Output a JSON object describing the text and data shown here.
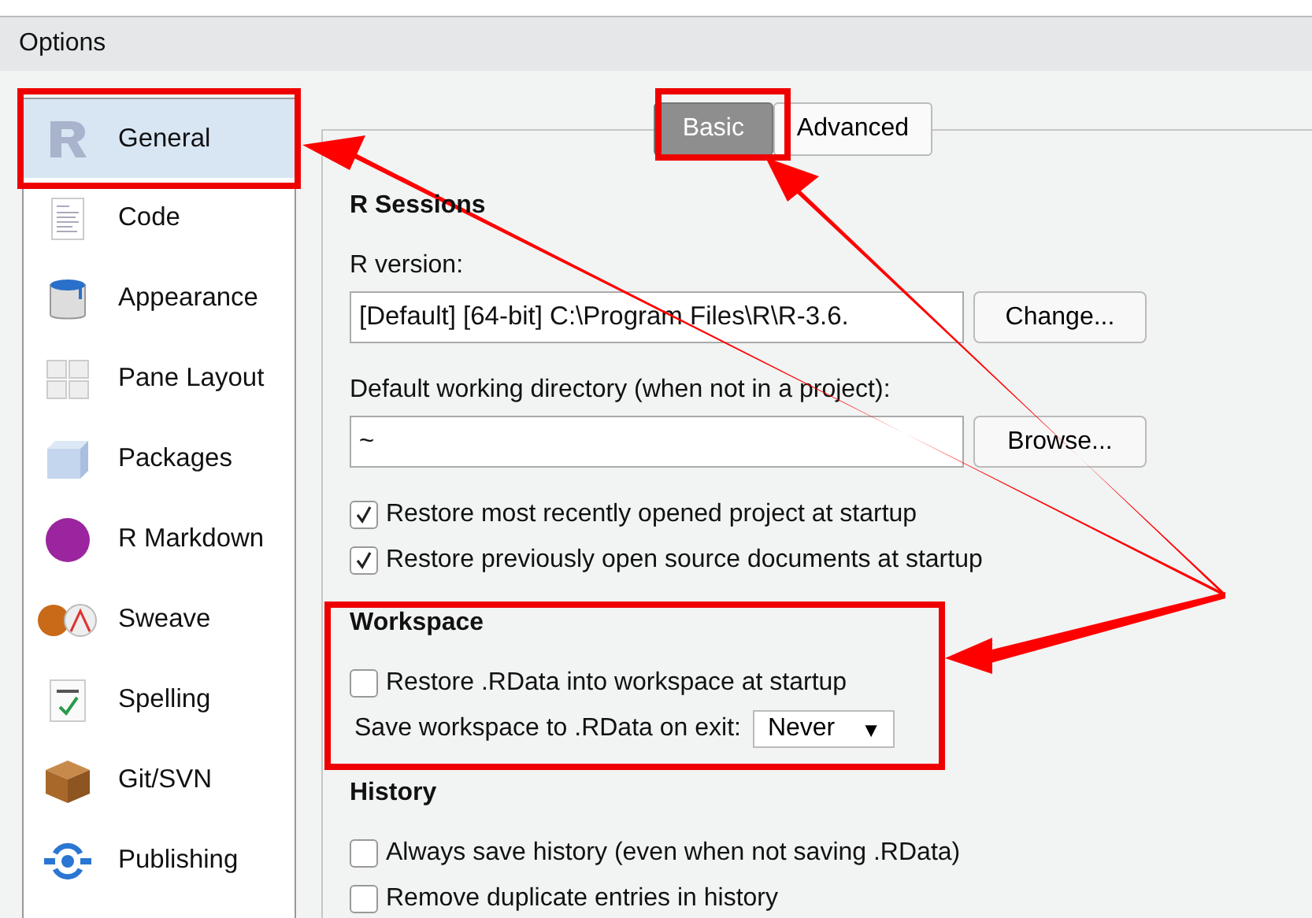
{
  "window": {
    "title": "Options"
  },
  "sidebar": {
    "items": [
      {
        "label": "General",
        "selected": true
      },
      {
        "label": "Code",
        "selected": false
      },
      {
        "label": "Appearance",
        "selected": false
      },
      {
        "label": "Pane Layout",
        "selected": false
      },
      {
        "label": "Packages",
        "selected": false
      },
      {
        "label": "R Markdown",
        "selected": false
      },
      {
        "label": "Sweave",
        "selected": false
      },
      {
        "label": "Spelling",
        "selected": false
      },
      {
        "label": "Git/SVN",
        "selected": false
      },
      {
        "label": "Publishing",
        "selected": false
      }
    ]
  },
  "tabs": [
    {
      "label": "Basic",
      "selected": true
    },
    {
      "label": "Advanced",
      "selected": false
    }
  ],
  "sections": [
    {
      "title": "R Sessions",
      "rows": [
        {
          "kind": "field",
          "label": "R version:",
          "value": "[Default] [64-bit] C:\\Program Files\\R\\R-3.6.",
          "button": "Change..."
        },
        {
          "kind": "field",
          "label": "Default working directory (when not in a project):",
          "value": "~",
          "button": "Browse..."
        },
        {
          "kind": "checkbox",
          "label": "Restore most recently opened project at startup",
          "checked": true
        },
        {
          "kind": "checkbox",
          "label": "Restore previously open source documents at startup",
          "checked": true
        }
      ]
    },
    {
      "title": "Workspace",
      "rows": [
        {
          "kind": "checkbox",
          "label": "Restore .RData into workspace at startup",
          "checked": false
        },
        {
          "kind": "select",
          "label": "Save workspace to .RData on exit:",
          "value": "Never",
          "caret": "▼"
        }
      ]
    },
    {
      "title": "History",
      "rows": [
        {
          "kind": "checkbox",
          "label": "Always save history (even when not saving .RData)",
          "checked": false
        },
        {
          "kind": "checkbox",
          "label": "Remove duplicate entries in history",
          "checked": false
        }
      ]
    }
  ]
}
